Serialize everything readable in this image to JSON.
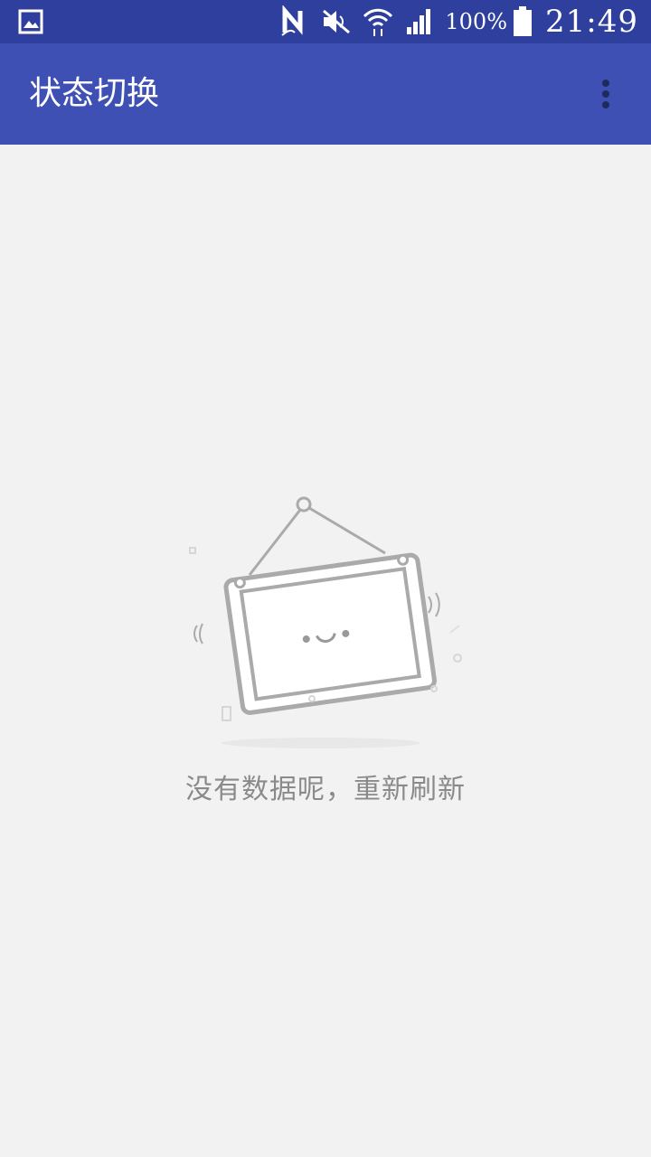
{
  "status_bar": {
    "battery_percent": "100%",
    "time": "21:49",
    "icons": [
      "image-icon",
      "nfc-icon",
      "mute-icon",
      "wifi-icon",
      "signal-icon",
      "battery-icon"
    ]
  },
  "app_bar": {
    "title": "状态切换",
    "overflow_icon": "more-vert-icon"
  },
  "empty_state": {
    "illustration": "hanging-sign-icon",
    "message": "没有数据呢，重新刷新"
  },
  "colors": {
    "status_bar": "#2f3f9e",
    "app_bar": "#3e50b4",
    "background": "#f2f2f2",
    "message_text": "#8a8a8a",
    "illustration_stroke": "#aaaaaa"
  }
}
